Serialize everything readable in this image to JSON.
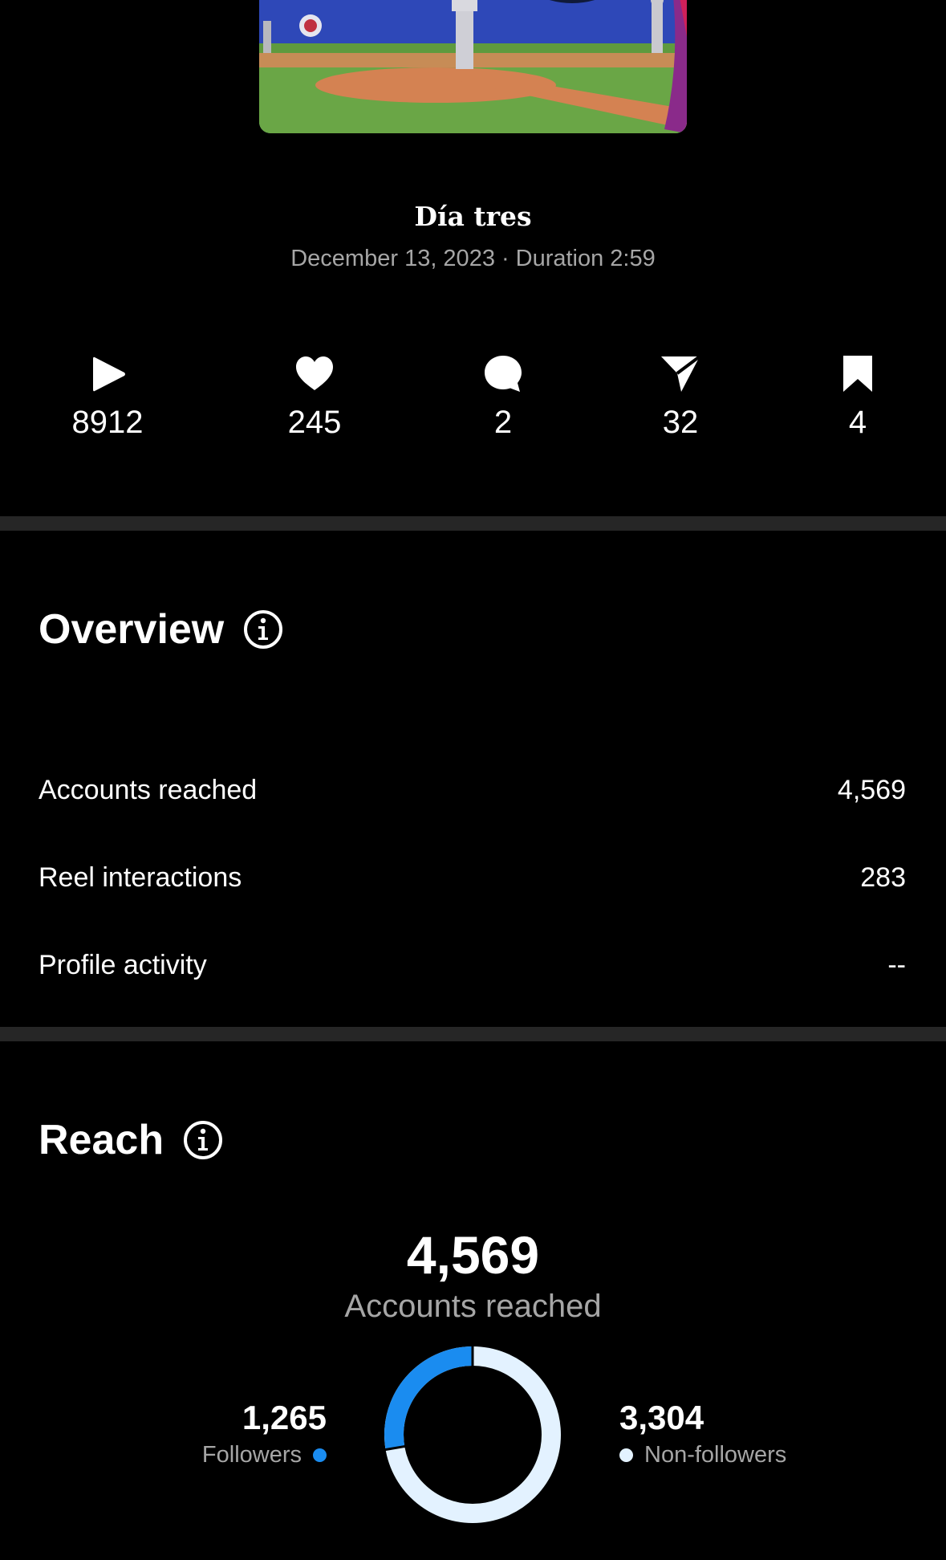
{
  "thumbnail": {
    "alt_icon": "baseball-field-thumbnail"
  },
  "reel": {
    "title": "Día tres",
    "date": "December 13, 2023",
    "separator": "·",
    "duration": "Duration 2:59"
  },
  "stats": [
    {
      "icon": "play-icon",
      "value": "8912"
    },
    {
      "icon": "heart-icon",
      "value": "245"
    },
    {
      "icon": "comment-icon",
      "value": "2"
    },
    {
      "icon": "share-icon",
      "value": "32"
    },
    {
      "icon": "bookmark-icon",
      "value": "4"
    }
  ],
  "overview": {
    "title": "Overview",
    "rows": [
      {
        "label": "Accounts reached",
        "value": "4,569"
      },
      {
        "label": "Reel interactions",
        "value": "283"
      },
      {
        "label": "Profile activity",
        "value": "--"
      }
    ]
  },
  "reach": {
    "title": "Reach",
    "total": "4,569",
    "total_label": "Accounts reached",
    "followers": {
      "value": "1,265",
      "label": "Followers",
      "color": "#1a8cf0"
    },
    "non_followers": {
      "value": "3,304",
      "label": "Non-followers",
      "color": "#e3f2ff"
    },
    "followers_fraction": 0.277
  },
  "colors": {
    "background": "#000000",
    "divider": "#262626",
    "muted_text": "#a6a6a6"
  }
}
